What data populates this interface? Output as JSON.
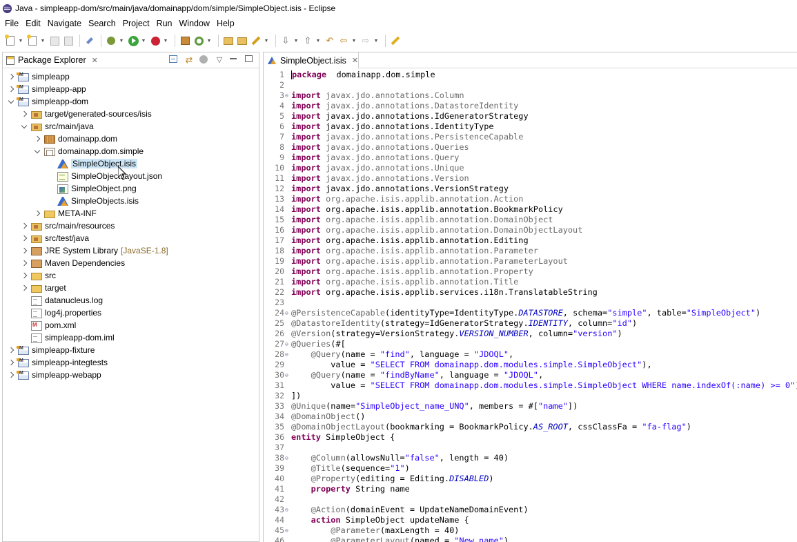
{
  "window": {
    "title": "Java - simpleapp-dom/src/main/java/domainapp/dom/simple/SimpleObject.isis - Eclipse"
  },
  "menu": [
    "File",
    "Edit",
    "Navigate",
    "Search",
    "Project",
    "Run",
    "Window",
    "Help"
  ],
  "package_explorer": {
    "tab_label": "Package Explorer",
    "tree": [
      {
        "label": "simpleapp",
        "icon": "project-icon",
        "depth": 0,
        "twisty": "closed"
      },
      {
        "label": "simpleapp-app",
        "icon": "project-icon",
        "depth": 0,
        "twisty": "closed"
      },
      {
        "label": "simpleapp-dom",
        "icon": "project-icon",
        "depth": 0,
        "twisty": "open"
      },
      {
        "label": "target/generated-sources/isis",
        "icon": "source-folder-icon",
        "depth": 1,
        "twisty": "closed"
      },
      {
        "label": "src/main/java",
        "icon": "source-folder-icon",
        "depth": 1,
        "twisty": "open"
      },
      {
        "label": "domainapp.dom",
        "icon": "package-icon",
        "depth": 2,
        "twisty": "closed"
      },
      {
        "label": "domainapp.dom.simple",
        "icon": "package-open-icon",
        "depth": 2,
        "twisty": "open"
      },
      {
        "label": "SimpleObject.isis",
        "icon": "isis-file-icon",
        "depth": 3,
        "twisty": "none",
        "selected": true
      },
      {
        "label": "SimpleObject.layout.json",
        "icon": "json-file-icon",
        "depth": 3,
        "twisty": "none"
      },
      {
        "label": "SimpleObject.png",
        "icon": "image-file-icon",
        "depth": 3,
        "twisty": "none"
      },
      {
        "label": "SimpleObjects.isis",
        "icon": "isis-file-icon",
        "depth": 3,
        "twisty": "none"
      },
      {
        "label": "META-INF",
        "icon": "folder-icon",
        "depth": 2,
        "twisty": "closed"
      },
      {
        "label": "src/main/resources",
        "icon": "source-folder-icon",
        "depth": 1,
        "twisty": "closed"
      },
      {
        "label": "src/test/java",
        "icon": "source-folder-icon",
        "depth": 1,
        "twisty": "closed"
      },
      {
        "label": "JRE System Library",
        "suffix": "[JavaSE-1.8]",
        "icon": "library-icon",
        "depth": 1,
        "twisty": "closed"
      },
      {
        "label": "Maven Dependencies",
        "icon": "library-icon",
        "depth": 1,
        "twisty": "closed"
      },
      {
        "label": "src",
        "icon": "folder-icon",
        "depth": 1,
        "twisty": "closed"
      },
      {
        "label": "target",
        "icon": "folder-icon",
        "depth": 1,
        "twisty": "closed"
      },
      {
        "label": "datanucleus.log",
        "icon": "text-file-icon",
        "depth": 1,
        "twisty": "none"
      },
      {
        "label": "log4j.properties",
        "icon": "text-file-icon",
        "depth": 1,
        "twisty": "none"
      },
      {
        "label": "pom.xml",
        "icon": "xml-file-icon",
        "depth": 1,
        "twisty": "none"
      },
      {
        "label": "simpleapp-dom.iml",
        "icon": "text-file-icon",
        "depth": 1,
        "twisty": "none"
      },
      {
        "label": "simpleapp-fixture",
        "icon": "project-icon",
        "depth": 0,
        "twisty": "closed"
      },
      {
        "label": "simpleapp-integtests",
        "icon": "project-icon",
        "depth": 0,
        "twisty": "closed"
      },
      {
        "label": "simpleapp-webapp",
        "icon": "project-icon",
        "depth": 0,
        "twisty": "closed"
      }
    ]
  },
  "editor": {
    "tab_label": "SimpleObject.isis",
    "lines": [
      {
        "n": "1",
        "fold": "",
        "segs": [
          [
            "kw",
            "package"
          ],
          [
            "",
            "  domainapp.dom.simple"
          ]
        ]
      },
      {
        "n": "2",
        "fold": "",
        "segs": []
      },
      {
        "n": "3",
        "fold": "⊖",
        "segs": [
          [
            "kw",
            "import"
          ],
          [
            "grey",
            " javax.jdo.annotations.Column"
          ]
        ]
      },
      {
        "n": "4",
        "fold": "",
        "segs": [
          [
            "kw",
            "import"
          ],
          [
            "grey",
            " javax.jdo.annotations.DatastoreIdentity"
          ]
        ]
      },
      {
        "n": "5",
        "fold": "",
        "segs": [
          [
            "kw",
            "import"
          ],
          [
            "",
            " javax.jdo.annotations.IdGeneratorStrategy"
          ]
        ]
      },
      {
        "n": "6",
        "fold": "",
        "segs": [
          [
            "kw",
            "import"
          ],
          [
            "",
            " javax.jdo.annotations.IdentityType"
          ]
        ]
      },
      {
        "n": "7",
        "fold": "",
        "segs": [
          [
            "kw",
            "import"
          ],
          [
            "grey",
            " javax.jdo.annotations.PersistenceCapable"
          ]
        ]
      },
      {
        "n": "8",
        "fold": "",
        "segs": [
          [
            "kw",
            "import"
          ],
          [
            "grey",
            " javax.jdo.annotations.Queries"
          ]
        ]
      },
      {
        "n": "9",
        "fold": "",
        "segs": [
          [
            "kw",
            "import"
          ],
          [
            "grey",
            " javax.jdo.annotations.Query"
          ]
        ]
      },
      {
        "n": "10",
        "fold": "",
        "segs": [
          [
            "kw",
            "import"
          ],
          [
            "grey",
            " javax.jdo.annotations.Unique"
          ]
        ]
      },
      {
        "n": "11",
        "fold": "",
        "segs": [
          [
            "kw",
            "import"
          ],
          [
            "grey",
            " javax.jdo.annotations.Version"
          ]
        ]
      },
      {
        "n": "12",
        "fold": "",
        "segs": [
          [
            "kw",
            "import"
          ],
          [
            "",
            " javax.jdo.annotations.VersionStrategy"
          ]
        ]
      },
      {
        "n": "13",
        "fold": "",
        "segs": [
          [
            "kw",
            "import"
          ],
          [
            "grey",
            " org.apache.isis.applib.annotation.Action"
          ]
        ]
      },
      {
        "n": "14",
        "fold": "",
        "segs": [
          [
            "kw",
            "import"
          ],
          [
            "",
            " org.apache.isis.applib.annotation.BookmarkPolicy"
          ]
        ]
      },
      {
        "n": "15",
        "fold": "",
        "segs": [
          [
            "kw",
            "import"
          ],
          [
            "grey",
            " org.apache.isis.applib.annotation.DomainObject"
          ]
        ]
      },
      {
        "n": "16",
        "fold": "",
        "segs": [
          [
            "kw",
            "import"
          ],
          [
            "grey",
            " org.apache.isis.applib.annotation.DomainObjectLayout"
          ]
        ]
      },
      {
        "n": "17",
        "fold": "",
        "segs": [
          [
            "kw",
            "import"
          ],
          [
            "",
            " org.apache.isis.applib.annotation.Editing"
          ]
        ]
      },
      {
        "n": "18",
        "fold": "",
        "segs": [
          [
            "kw",
            "import"
          ],
          [
            "grey",
            " org.apache.isis.applib.annotation.Parameter"
          ]
        ]
      },
      {
        "n": "19",
        "fold": "",
        "segs": [
          [
            "kw",
            "import"
          ],
          [
            "grey",
            " org.apache.isis.applib.annotation.ParameterLayout"
          ]
        ]
      },
      {
        "n": "20",
        "fold": "",
        "segs": [
          [
            "kw",
            "import"
          ],
          [
            "grey",
            " org.apache.isis.applib.annotation.Property"
          ]
        ]
      },
      {
        "n": "21",
        "fold": "",
        "segs": [
          [
            "kw",
            "import"
          ],
          [
            "grey",
            " org.apache.isis.applib.annotation.Title"
          ]
        ]
      },
      {
        "n": "22",
        "fold": "",
        "segs": [
          [
            "kw",
            "import"
          ],
          [
            "",
            " org.apache.isis.applib.services.i18n.TranslatableString"
          ]
        ]
      },
      {
        "n": "23",
        "fold": "",
        "segs": []
      },
      {
        "n": "24",
        "fold": "⊖",
        "segs": [
          [
            "ann",
            "@PersistenceCapable"
          ],
          [
            "",
            "(identityType=IdentityType."
          ],
          [
            "ital",
            "DATASTORE"
          ],
          [
            "",
            ", schema="
          ],
          [
            "str",
            "\"simple\""
          ],
          [
            "",
            ", table="
          ],
          [
            "str",
            "\"SimpleObject\""
          ],
          [
            "",
            ")"
          ]
        ]
      },
      {
        "n": "25",
        "fold": "",
        "segs": [
          [
            "ann",
            "@DatastoreIdentity"
          ],
          [
            "",
            "(strategy=IdGeneratorStrategy."
          ],
          [
            "ital",
            "IDENTITY"
          ],
          [
            "",
            ", column="
          ],
          [
            "str",
            "\"id\""
          ],
          [
            "",
            ")"
          ]
        ]
      },
      {
        "n": "26",
        "fold": "",
        "segs": [
          [
            "ann",
            "@Version"
          ],
          [
            "",
            "(strategy=VersionStrategy."
          ],
          [
            "ital",
            "VERSION_NUMBER"
          ],
          [
            "",
            ", column="
          ],
          [
            "str",
            "\"version\""
          ],
          [
            "",
            ")"
          ]
        ]
      },
      {
        "n": "27",
        "fold": "⊖",
        "segs": [
          [
            "ann",
            "@Queries"
          ],
          [
            "",
            "(#["
          ]
        ]
      },
      {
        "n": "28",
        "fold": "⊖",
        "segs": [
          [
            "",
            "    "
          ],
          [
            "ann",
            "@Query"
          ],
          [
            "",
            "(name = "
          ],
          [
            "str",
            "\"find\""
          ],
          [
            "",
            ", language = "
          ],
          [
            "str",
            "\"JDOQL\""
          ],
          [
            "",
            ","
          ]
        ]
      },
      {
        "n": "29",
        "fold": "",
        "segs": [
          [
            "",
            "        value = "
          ],
          [
            "str",
            "\"SELECT FROM domainapp.dom.modules.simple.SimpleObject\""
          ],
          [
            "",
            "),"
          ]
        ]
      },
      {
        "n": "30",
        "fold": "⊖",
        "segs": [
          [
            "",
            "    "
          ],
          [
            "ann",
            "@Query"
          ],
          [
            "",
            "(name = "
          ],
          [
            "str",
            "\"findByName\""
          ],
          [
            "",
            ", language = "
          ],
          [
            "str",
            "\"JDOQL\""
          ],
          [
            "",
            ","
          ]
        ]
      },
      {
        "n": "31",
        "fold": "",
        "segs": [
          [
            "",
            "        value = "
          ],
          [
            "str",
            "\"SELECT FROM domainapp.dom.modules.simple.SimpleObject WHERE name.indexOf(:name) >= 0\""
          ],
          [
            "",
            ")"
          ]
        ]
      },
      {
        "n": "32",
        "fold": "",
        "segs": [
          [
            "",
            "])"
          ]
        ]
      },
      {
        "n": "33",
        "fold": "",
        "segs": [
          [
            "ann",
            "@Unique"
          ],
          [
            "",
            "(name="
          ],
          [
            "str",
            "\"SimpleObject_name_UNQ\""
          ],
          [
            "",
            ", members = #["
          ],
          [
            "str",
            "\"name\""
          ],
          [
            "",
            "])"
          ]
        ]
      },
      {
        "n": "34",
        "fold": "",
        "segs": [
          [
            "ann",
            "@DomainObject"
          ],
          [
            "",
            "()"
          ]
        ]
      },
      {
        "n": "35",
        "fold": "",
        "segs": [
          [
            "ann",
            "@DomainObjectLayout"
          ],
          [
            "",
            "(bookmarking = BookmarkPolicy."
          ],
          [
            "ital",
            "AS_ROOT"
          ],
          [
            "",
            ", cssClassFa = "
          ],
          [
            "str",
            "\"fa-flag\""
          ],
          [
            "",
            ")"
          ]
        ]
      },
      {
        "n": "36",
        "fold": "",
        "segs": [
          [
            "kw",
            "entity"
          ],
          [
            "",
            " SimpleObject {"
          ]
        ]
      },
      {
        "n": "37",
        "fold": "",
        "segs": []
      },
      {
        "n": "38",
        "fold": "⊖",
        "segs": [
          [
            "",
            "    "
          ],
          [
            "ann",
            "@Column"
          ],
          [
            "",
            "(allowsNull="
          ],
          [
            "str",
            "\"false\""
          ],
          [
            "",
            ", length = 40)"
          ]
        ]
      },
      {
        "n": "39",
        "fold": "",
        "segs": [
          [
            "",
            "    "
          ],
          [
            "ann",
            "@Title"
          ],
          [
            "",
            "(sequence="
          ],
          [
            "str",
            "\"1\""
          ],
          [
            "",
            ")"
          ]
        ]
      },
      {
        "n": "40",
        "fold": "",
        "segs": [
          [
            "",
            "    "
          ],
          [
            "ann",
            "@Property"
          ],
          [
            "",
            "(editing = Editing."
          ],
          [
            "ital",
            "DISABLED"
          ],
          [
            "",
            ")"
          ]
        ]
      },
      {
        "n": "41",
        "fold": "",
        "segs": [
          [
            "",
            "    "
          ],
          [
            "kw",
            "property"
          ],
          [
            "",
            " String name"
          ]
        ]
      },
      {
        "n": "42",
        "fold": "",
        "segs": []
      },
      {
        "n": "43",
        "fold": "⊖",
        "segs": [
          [
            "",
            "    "
          ],
          [
            "ann",
            "@Action"
          ],
          [
            "",
            "(domainEvent = UpdateNameDomainEvent)"
          ]
        ]
      },
      {
        "n": "44",
        "fold": "",
        "segs": [
          [
            "",
            "    "
          ],
          [
            "kw",
            "action"
          ],
          [
            "",
            " SimpleObject updateName {"
          ]
        ]
      },
      {
        "n": "45",
        "fold": "⊖",
        "segs": [
          [
            "",
            "        "
          ],
          [
            "ann",
            "@Parameter"
          ],
          [
            "",
            "(maxLength = 40)"
          ]
        ]
      },
      {
        "n": "46",
        "fold": "",
        "segs": [
          [
            "",
            "        "
          ],
          [
            "ann",
            "@ParameterLayout"
          ],
          [
            "",
            "(named = "
          ],
          [
            "str",
            "\"New name\""
          ],
          [
            "",
            ")"
          ]
        ]
      }
    ]
  }
}
